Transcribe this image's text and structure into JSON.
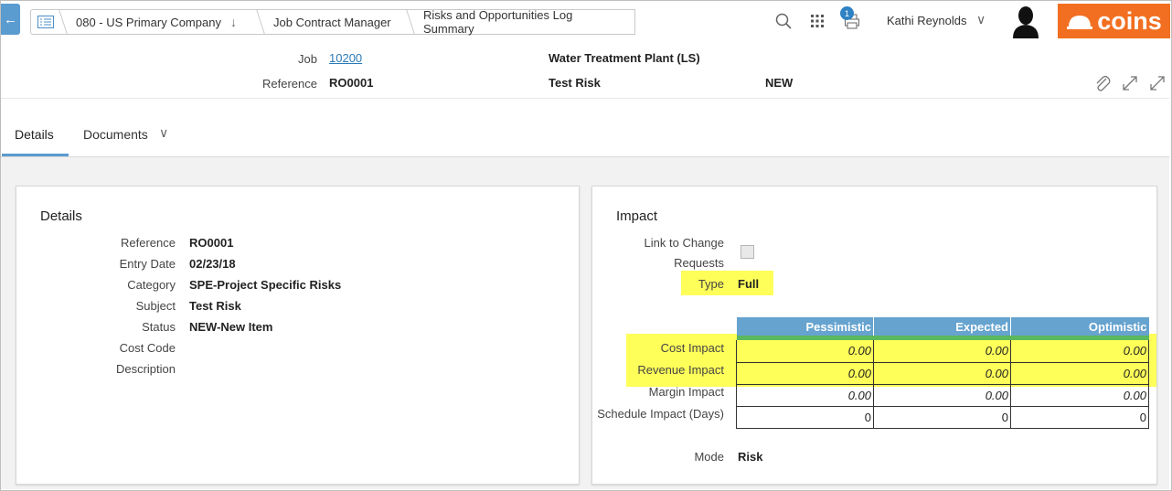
{
  "breadcrumb": {
    "company": "080 - US Primary Company",
    "module": "Job Contract Manager",
    "page": "Risks and Opportunities Log Summary"
  },
  "header": {
    "print_badge": "1",
    "user_name": "Kathi Reynolds",
    "logo_text": "coins",
    "job_label": "Job",
    "job_value": "10200",
    "job_name": "Water Treatment Plant (LS)",
    "reference_label": "Reference",
    "reference_value": "RO0001",
    "reference_name": "Test Risk",
    "status": "NEW"
  },
  "tabs": [
    {
      "label": "Details",
      "active": true
    },
    {
      "label": "Documents",
      "active": false
    }
  ],
  "details": {
    "title": "Details",
    "fields": [
      {
        "label": "Reference",
        "value": "RO0001"
      },
      {
        "label": "Entry Date",
        "value": "02/23/18"
      },
      {
        "label": "Category",
        "value": "SPE-Project Specific Risks"
      },
      {
        "label": "Subject",
        "value": "Test Risk"
      },
      {
        "label": "Status",
        "value": "NEW-New Item"
      },
      {
        "label": "Cost Code",
        "value": ""
      },
      {
        "label": "Description",
        "value": ""
      }
    ]
  },
  "impact": {
    "title": "Impact",
    "link_label_line1": "Link to Change",
    "link_label_line2": "Requests",
    "link_checked": false,
    "type_label": "Type",
    "type_value": "Full",
    "columns": [
      "Pessimistic",
      "Expected",
      "Optimistic"
    ],
    "rows": [
      {
        "label": "Cost Impact",
        "values": [
          "0.00",
          "0.00",
          "0.00"
        ]
      },
      {
        "label": "Revenue Impact",
        "values": [
          "0.00",
          "0.00",
          "0.00"
        ]
      },
      {
        "label": "Margin Impact",
        "values": [
          "0.00",
          "0.00",
          "0.00"
        ]
      },
      {
        "label": "Schedule Impact (Days)",
        "values": [
          "0",
          "0",
          "0"
        ]
      }
    ],
    "mode_label": "Mode",
    "mode_value": "Risk"
  },
  "colors": {
    "accent": "#5a9bd0",
    "brand": "#f26f21",
    "highlight": "#ffff59",
    "table_header": "#66a3cf"
  }
}
